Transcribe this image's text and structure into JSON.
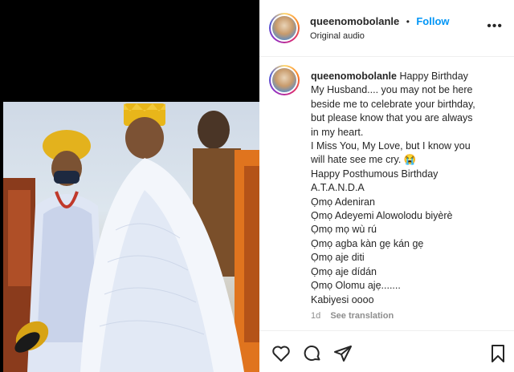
{
  "post": {
    "username": "queenomobolanle",
    "separator": "•",
    "follow_label": "Follow",
    "audio": "Original audio",
    "more_label": "•••",
    "caption_lines": [
      "Happy Birthday",
      "My Husband.... you may not be here",
      "beside me to celebrate your birthday,",
      "but please know that you are always",
      "in my heart.",
      "I Miss You, My Love, but I know you",
      "will hate see me cry.",
      "Happy Posthumous Birthday",
      "A.T.A.N.D.A",
      "Ọmọ Adeniran",
      "Ọmọ Adeyemi Alowolodu biyèrè",
      "Ọmọ mọ wù rú",
      "Ọmọ agba kàn gẹ kán gẹ",
      "Ọmọ aje diti",
      "Ọmọ aje dídán",
      "Ọmọ Olomu ajẹ.......",
      "Kabiyesi oooo"
    ],
    "emoji": "😭",
    "time_ago": "1d",
    "see_translation": "See translation"
  },
  "icons": {
    "like": "heart-icon",
    "comment": "comment-icon",
    "share": "send-icon",
    "save": "bookmark-icon"
  }
}
